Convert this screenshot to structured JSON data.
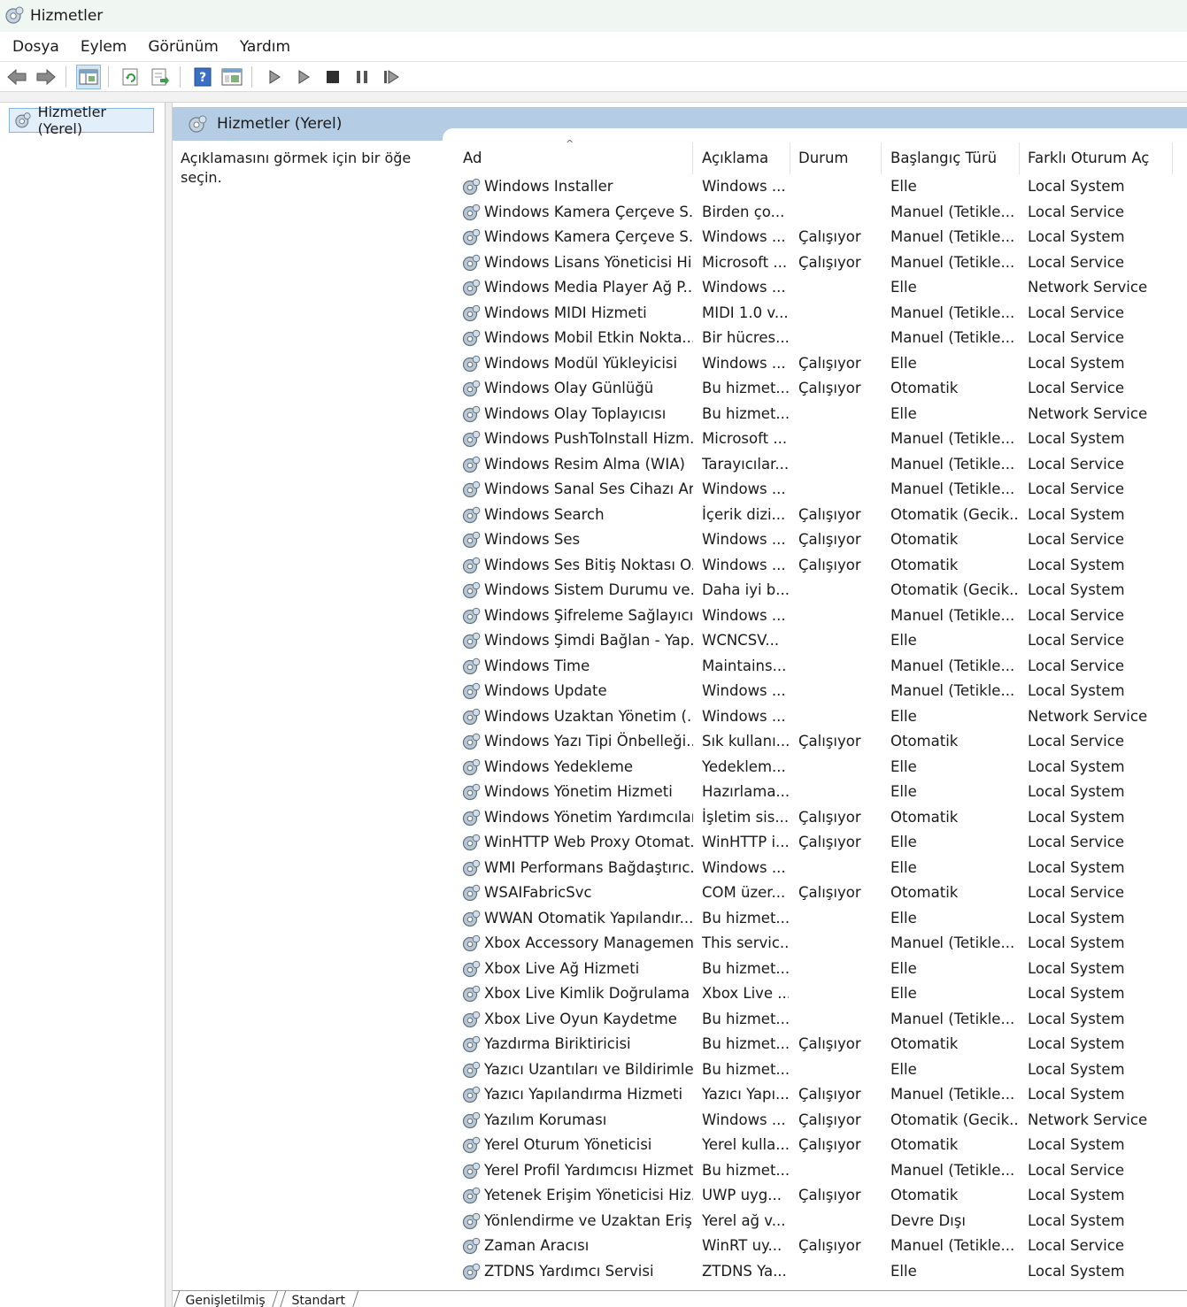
{
  "window": {
    "title": "Hizmetler",
    "icon": "gear-icon"
  },
  "menu": [
    "Dosya",
    "Eylem",
    "Görünüm",
    "Yardım"
  ],
  "toolbar": {
    "buttons": [
      "back-arrow-icon",
      "forward-arrow-icon",
      "console-tree-icon",
      "refresh-icon",
      "export-list-icon",
      "help-icon",
      "properties-icon",
      "start-service-icon",
      "start-service-alt-icon",
      "stop-service-icon",
      "pause-service-icon",
      "resume-service-icon"
    ]
  },
  "tree": {
    "node_label": "Hizmetler (Yerel)"
  },
  "panel": {
    "header": "Hizmetler (Yerel)",
    "description": "Açıklamasını görmek için bir öğe seçin."
  },
  "columns": {
    "name": "Ad",
    "description": "Açıklama",
    "status": "Durum",
    "startup": "Başlangıç Türü",
    "logon": "Farklı Oturum Aç"
  },
  "services": [
    {
      "name": "Windows Installer",
      "desc": "Windows ...",
      "status": "",
      "startup": "Elle",
      "logon": "Local System"
    },
    {
      "name": "Windows Kamera Çerçeve S...",
      "desc": "Birden ço...",
      "status": "",
      "startup": "Manuel (Tetikle...",
      "logon": "Local Service"
    },
    {
      "name": "Windows Kamera Çerçeve S...",
      "desc": "Windows ...",
      "status": "Çalışıyor",
      "startup": "Manuel (Tetikle...",
      "logon": "Local System"
    },
    {
      "name": "Windows Lisans Yöneticisi Hi...",
      "desc": "Microsoft ...",
      "status": "Çalışıyor",
      "startup": "Manuel (Tetikle...",
      "logon": "Local Service"
    },
    {
      "name": "Windows Media Player Ağ P...",
      "desc": "Windows ...",
      "status": "",
      "startup": "Elle",
      "logon": "Network Service"
    },
    {
      "name": "Windows MIDI Hizmeti",
      "desc": "MIDI 1.0 v...",
      "status": "",
      "startup": "Manuel (Tetikle...",
      "logon": "Local Service"
    },
    {
      "name": "Windows Mobil Etkin Nokta...",
      "desc": "Bir hücres...",
      "status": "",
      "startup": "Manuel (Tetikle...",
      "logon": "Local Service"
    },
    {
      "name": "Windows Modül Yükleyicisi",
      "desc": "Windows ...",
      "status": "Çalışıyor",
      "startup": "Elle",
      "logon": "Local System"
    },
    {
      "name": "Windows Olay Günlüğü",
      "desc": "Bu hizmet...",
      "status": "Çalışıyor",
      "startup": "Otomatik",
      "logon": "Local Service"
    },
    {
      "name": "Windows Olay Toplayıcısı",
      "desc": "Bu hizmet...",
      "status": "",
      "startup": "Elle",
      "logon": "Network Service"
    },
    {
      "name": "Windows PushToInstall Hizm...",
      "desc": "Microsoft ...",
      "status": "",
      "startup": "Manuel (Tetikle...",
      "logon": "Local System"
    },
    {
      "name": "Windows Resim Alma (WIA)",
      "desc": "Tarayıcılar...",
      "status": "",
      "startup": "Manuel (Tetikle...",
      "logon": "Local Service"
    },
    {
      "name": "Windows Sanal Ses Cihazı Ar...",
      "desc": "Windows ...",
      "status": "",
      "startup": "Manuel (Tetikle...",
      "logon": "Local Service"
    },
    {
      "name": "Windows Search",
      "desc": "İçerik dizi...",
      "status": "Çalışıyor",
      "startup": "Otomatik (Gecik...",
      "logon": "Local System"
    },
    {
      "name": "Windows Ses",
      "desc": "Windows ...",
      "status": "Çalışıyor",
      "startup": "Otomatik",
      "logon": "Local Service"
    },
    {
      "name": "Windows Ses Bitiş Noktası O...",
      "desc": "Windows ...",
      "status": "Çalışıyor",
      "startup": "Otomatik",
      "logon": "Local System"
    },
    {
      "name": "Windows Sistem Durumu ve...",
      "desc": "Daha iyi b...",
      "status": "",
      "startup": "Otomatik (Gecik...",
      "logon": "Local System"
    },
    {
      "name": "Windows Şifreleme Sağlayıcı...",
      "desc": "Windows ...",
      "status": "",
      "startup": "Manuel (Tetikle...",
      "logon": "Local Service"
    },
    {
      "name": "Windows Şimdi Bağlan - Yap...",
      "desc": "WCNCSV...",
      "status": "",
      "startup": "Elle",
      "logon": "Local Service"
    },
    {
      "name": "Windows Time",
      "desc": "Maintains...",
      "status": "",
      "startup": "Manuel (Tetikle...",
      "logon": "Local Service"
    },
    {
      "name": "Windows Update",
      "desc": "Windows ...",
      "status": "",
      "startup": "Manuel (Tetikle...",
      "logon": "Local System"
    },
    {
      "name": "Windows Uzaktan Yönetim (...",
      "desc": "Windows ...",
      "status": "",
      "startup": "Elle",
      "logon": "Network Service"
    },
    {
      "name": "Windows Yazı Tipi Önbelleği...",
      "desc": "Sık kullanı...",
      "status": "Çalışıyor",
      "startup": "Otomatik",
      "logon": "Local Service"
    },
    {
      "name": "Windows Yedekleme",
      "desc": "Yedeklem...",
      "status": "",
      "startup": "Elle",
      "logon": "Local System"
    },
    {
      "name": "Windows Yönetim Hizmeti",
      "desc": "Hazırlama...",
      "status": "",
      "startup": "Elle",
      "logon": "Local System"
    },
    {
      "name": "Windows Yönetim Yardımcıları",
      "desc": "İşletim sis...",
      "status": "Çalışıyor",
      "startup": "Otomatik",
      "logon": "Local System"
    },
    {
      "name": "WinHTTP Web Proxy Otomat...",
      "desc": "WinHTTP i...",
      "status": "Çalışıyor",
      "startup": "Elle",
      "logon": "Local Service"
    },
    {
      "name": "WMI Performans Bağdaştırıc...",
      "desc": "Windows ...",
      "status": "",
      "startup": "Elle",
      "logon": "Local System"
    },
    {
      "name": "WSAIFabricSvc",
      "desc": "COM üzer...",
      "status": "Çalışıyor",
      "startup": "Otomatik",
      "logon": "Local Service"
    },
    {
      "name": "WWAN Otomatik Yapılandır...",
      "desc": "Bu hizmet...",
      "status": "",
      "startup": "Elle",
      "logon": "Local System"
    },
    {
      "name": "Xbox Accessory Managemen...",
      "desc": "This servic...",
      "status": "",
      "startup": "Manuel (Tetikle...",
      "logon": "Local System"
    },
    {
      "name": "Xbox Live Ağ Hizmeti",
      "desc": "Bu hizmet...",
      "status": "",
      "startup": "Elle",
      "logon": "Local System"
    },
    {
      "name": "Xbox Live Kimlik Doğrulama ...",
      "desc": "Xbox Live ...",
      "status": "",
      "startup": "Elle",
      "logon": "Local System"
    },
    {
      "name": "Xbox Live Oyun Kaydetme",
      "desc": "Bu hizmet...",
      "status": "",
      "startup": "Manuel (Tetikle...",
      "logon": "Local System"
    },
    {
      "name": "Yazdırma Biriktiricisi",
      "desc": "Bu hizmet...",
      "status": "Çalışıyor",
      "startup": "Otomatik",
      "logon": "Local System"
    },
    {
      "name": "Yazıcı Uzantıları ve Bildirimleri",
      "desc": "Bu hizmet...",
      "status": "",
      "startup": "Elle",
      "logon": "Local System"
    },
    {
      "name": "Yazıcı Yapılandırma Hizmeti",
      "desc": "Yazıcı Yapı...",
      "status": "Çalışıyor",
      "startup": "Manuel (Tetikle...",
      "logon": "Local System"
    },
    {
      "name": "Yazılım Koruması",
      "desc": "Windows ...",
      "status": "Çalışıyor",
      "startup": "Otomatik (Gecik...",
      "logon": "Network Service"
    },
    {
      "name": "Yerel Oturum Yöneticisi",
      "desc": "Yerel kulla...",
      "status": "Çalışıyor",
      "startup": "Otomatik",
      "logon": "Local System"
    },
    {
      "name": "Yerel Profil Yardımcısı Hizmeti",
      "desc": "Bu hizmet...",
      "status": "",
      "startup": "Manuel (Tetikle...",
      "logon": "Local Service"
    },
    {
      "name": "Yetenek Erişim Yöneticisi Hiz...",
      "desc": "UWP uyg...",
      "status": "Çalışıyor",
      "startup": "Otomatik",
      "logon": "Local System"
    },
    {
      "name": "Yönlendirme ve Uzaktan Eriş...",
      "desc": "Yerel ağ v...",
      "status": "",
      "startup": "Devre Dışı",
      "logon": "Local System"
    },
    {
      "name": "Zaman Aracısı",
      "desc": "WinRT uy...",
      "status": "Çalışıyor",
      "startup": "Manuel (Tetikle...",
      "logon": "Local Service"
    },
    {
      "name": "ZTDNS Yardımcı Servisi",
      "desc": "ZTDNS Ya...",
      "status": "",
      "startup": "Elle",
      "logon": "Local System"
    }
  ],
  "tabs": [
    "Genişletilmiş",
    "Standart"
  ],
  "colors": {
    "panel_header": "#b5cde4",
    "selection": "#e2eef9"
  }
}
